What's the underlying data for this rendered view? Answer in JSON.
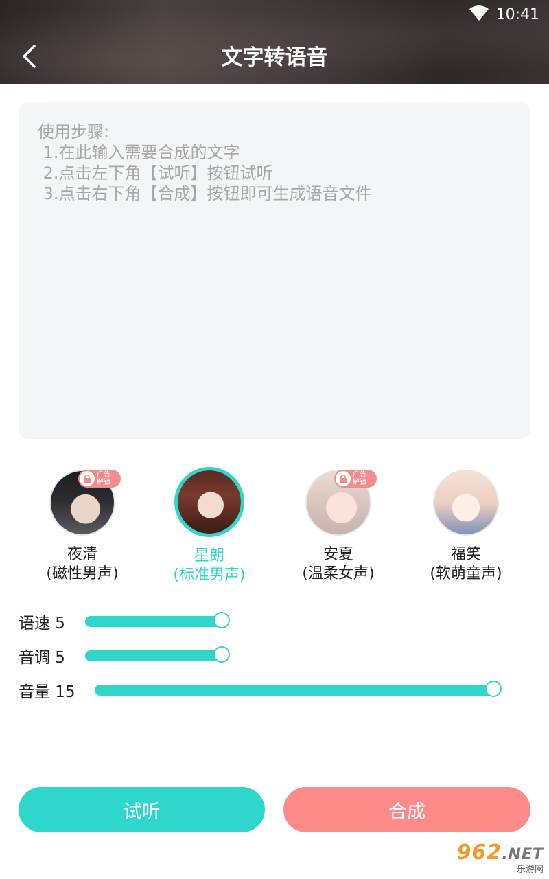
{
  "status": {
    "time": "10:41"
  },
  "header": {
    "title": "文字转语音"
  },
  "editor": {
    "placeholder_lines": [
      "使用步骤:",
      " 1.在此输入需要合成的文字",
      " 2.点击左下角【试听】按钮试听",
      " 3.点击右下角【合成】按钮即可生成语音文件"
    ]
  },
  "voices": [
    {
      "name": "夜清",
      "desc": "(磁性男声)",
      "locked": true,
      "selected": false,
      "badge": [
        "广告",
        "解锁"
      ]
    },
    {
      "name": "星朗",
      "desc": "(标准男声)",
      "locked": false,
      "selected": true
    },
    {
      "name": "安夏",
      "desc": "(温柔女声)",
      "locked": true,
      "selected": false,
      "badge": [
        "广告",
        "解锁"
      ]
    },
    {
      "name": "福笑",
      "desc": "(软萌童声)",
      "locked": false,
      "selected": false
    }
  ],
  "sliders": {
    "speed": {
      "label": "语速 5",
      "value": 5
    },
    "pitch": {
      "label": "音调 5",
      "value": 5
    },
    "volume": {
      "label": "音量 15",
      "value": 15
    }
  },
  "buttons": {
    "listen": "试听",
    "synthesize": "合成"
  },
  "watermark": {
    "logo": "962",
    "logo_suffix": ".NET",
    "sub": "乐游网"
  },
  "colors": {
    "accent": "#2ed6cc",
    "synth": "#ff8a8a",
    "badge": "#f08c8c"
  }
}
